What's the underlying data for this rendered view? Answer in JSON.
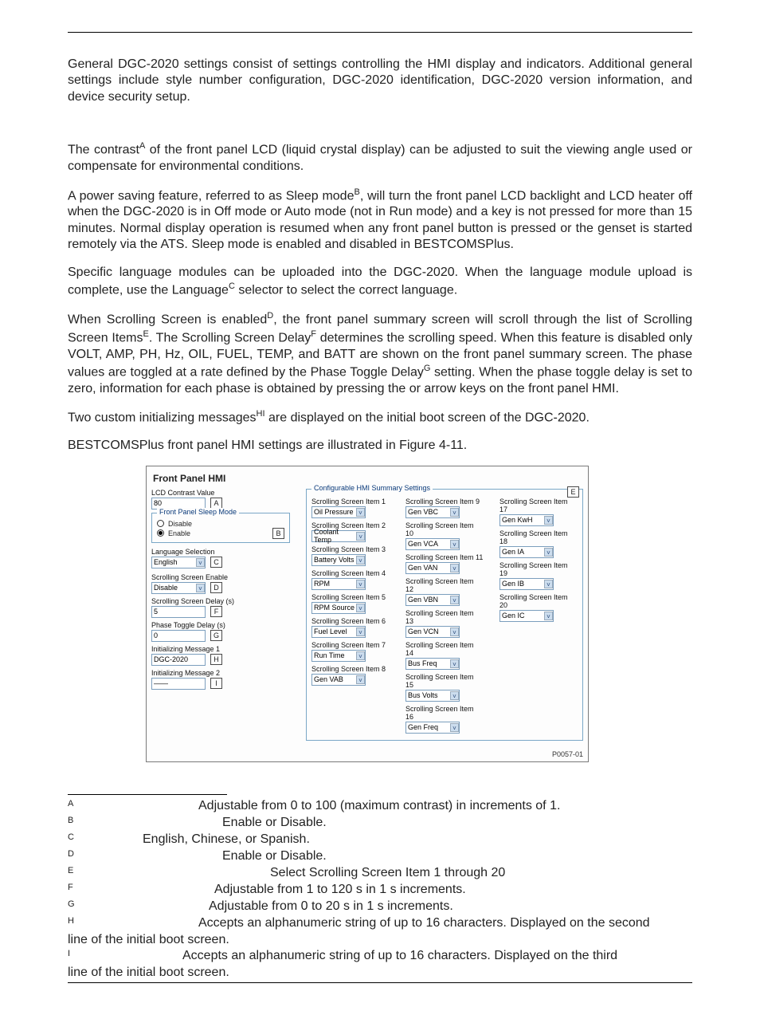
{
  "intro": {
    "p1": "General DGC-2020 settings consist of settings controlling the HMI display and indicators. Additional general settings include style number configuration, DGC-2020 identification, DGC-2020 version information, and device security setup.",
    "p2a": "The contrast",
    "p2b": " of the front panel LCD (liquid crystal display) can be adjusted to suit the viewing angle used or compensate for environmental conditions.",
    "p3a": "A power saving feature, referred to as Sleep mode",
    "p3b": ", will turn the front panel LCD backlight and LCD heater off when the DGC-2020 is in Off mode or Auto mode (not in Run mode) and a key is not pressed for more than 15 minutes. Normal display operation is resumed when any front panel button is pressed or the genset is started remotely via the ATS. Sleep mode is enabled and disabled in BESTCOMSPlus.",
    "p4a": "Specific language modules can be uploaded into the DGC-2020. When the language module upload is complete, use the Language",
    "p4b": " selector to select the correct language.",
    "p5a": "When Scrolling Screen is enabled",
    "p5b": ", the front panel summary screen will scroll through the list of Scrolling Screen Items",
    "p5c": ". The Scrolling Screen Delay",
    "p5d": " determines the scrolling speed. When this feature is disabled only VOLT, AMP, PH, Hz, OIL, FUEL, TEMP, and BATT are shown on the front panel summary screen. The phase values are toggled at a rate defined by the Phase Toggle Delay",
    "p5e": " setting. When the phase toggle delay is set to zero, information for each phase is obtained by pressing the       or        arrow keys on the front panel HMI.",
    "p6a": "Two custom initializing messages",
    "p6b": " are displayed on the initial boot screen of the DGC-2020.",
    "p7": "BESTCOMSPlus front panel HMI settings are illustrated in Figure 4-11."
  },
  "sup": {
    "A": "A",
    "B": "B",
    "C": "C",
    "D": "D",
    "E": "E",
    "F": "F",
    "G": "G",
    "HI": "HI"
  },
  "panel": {
    "title": "Front Panel HMI",
    "id": "P0057-01",
    "left": {
      "contrast_label": "LCD Contrast Value",
      "contrast_value": "80",
      "sleep_group": "Front Panel Sleep Mode",
      "sleep_disable": "Disable",
      "sleep_enable": "Enable",
      "lang_label": "Language Selection",
      "lang_value": "English",
      "scroll_en_label": "Scrolling Screen Enable",
      "scroll_en_value": "Disable",
      "scroll_delay_label": "Scrolling Screen Delay (s)",
      "scroll_delay_value": "5",
      "phase_label": "Phase Toggle Delay (s)",
      "phase_value": "0",
      "init1_label": "Initializing Message 1",
      "init1_value": "DGC-2020",
      "init2_label": "Initializing Message 2",
      "init2_value": "——"
    },
    "letters": {
      "A": "A",
      "B": "B",
      "C": "C",
      "D": "D",
      "E": "E",
      "F": "F",
      "G": "G",
      "H": "H",
      "I": "I"
    },
    "summary_title": "Configurable HMI Summary Settings",
    "items": [
      {
        "label": "Scrolling Screen Item 1",
        "value": "Oil Pressure"
      },
      {
        "label": "Scrolling Screen Item 2",
        "value": "Coolant Temp"
      },
      {
        "label": "Scrolling Screen Item 3",
        "value": "Battery Volts"
      },
      {
        "label": "Scrolling Screen Item 4",
        "value": "RPM"
      },
      {
        "label": "Scrolling Screen Item 5",
        "value": "RPM Source"
      },
      {
        "label": "Scrolling Screen Item 6",
        "value": "Fuel Level"
      },
      {
        "label": "Scrolling Screen Item 7",
        "value": "Run Time"
      },
      {
        "label": "Scrolling Screen Item 8",
        "value": "Gen VAB"
      },
      {
        "label": "Scrolling Screen Item 9",
        "value": "Gen VBC"
      },
      {
        "label": "Scrolling Screen Item 10",
        "value": "Gen VCA"
      },
      {
        "label": "Scrolling Screen Item 11",
        "value": "Gen VAN"
      },
      {
        "label": "Scrolling Screen Item 12",
        "value": "Gen VBN"
      },
      {
        "label": "Scrolling Screen Item 13",
        "value": "Gen VCN"
      },
      {
        "label": "Scrolling Screen Item 14",
        "value": "Bus Freq"
      },
      {
        "label": "Scrolling Screen Item 15",
        "value": "Bus Volts"
      },
      {
        "label": "Scrolling Screen Item 16",
        "value": "Gen Freq"
      },
      {
        "label": "Scrolling Screen Item 17",
        "value": "Gen KwH"
      },
      {
        "label": "Scrolling Screen Item 18",
        "value": "Gen IA"
      },
      {
        "label": "Scrolling Screen Item 19",
        "value": "Gen IB"
      },
      {
        "label": "Scrolling Screen Item 20",
        "value": "Gen IC"
      }
    ]
  },
  "footnotes": {
    "A": "Adjustable from 0 to 100 (maximum contrast) in increments of 1.",
    "B": "Enable or Disable.",
    "C": "English, Chinese, or Spanish.",
    "D": "Enable or Disable.",
    "E": "Select Scrolling Screen Item 1 through 20",
    "F": "Adjustable from 1 to 120 s in 1 s increments.",
    "G": "Adjustable from 0 to 20 s in 1 s increments.",
    "H": "Accepts an alphanumeric string of up to 16 characters. Displayed on the second",
    "H2": "line of the initial boot screen.",
    "I": "Accepts an alphanumeric string of up to 16 characters. Displayed on the third",
    "I2": "line of the initial boot screen."
  }
}
